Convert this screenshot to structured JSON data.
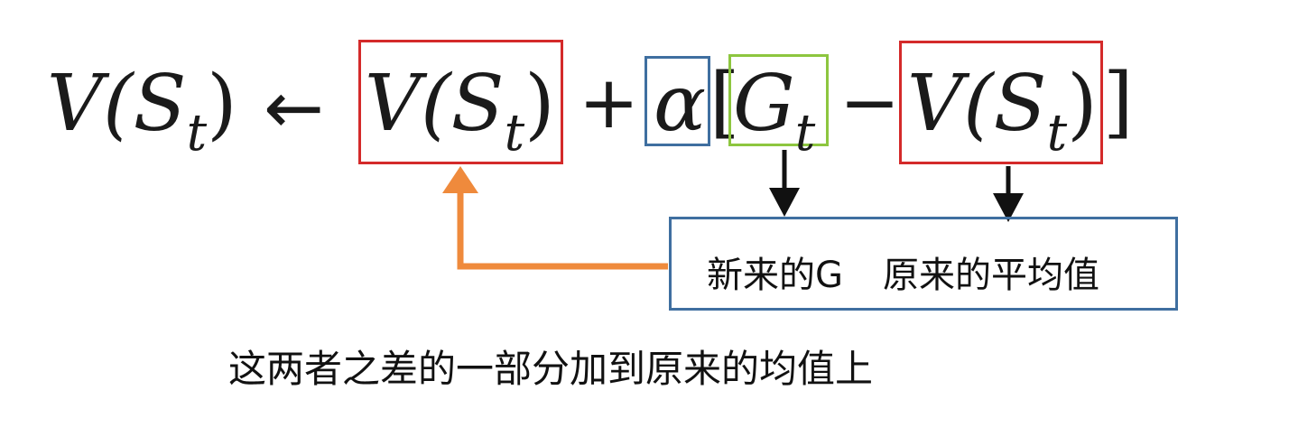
{
  "formula": {
    "lhs_V": "V",
    "lhs_S": "(S",
    "lhs_t": "t",
    "lhs_close": ")",
    "arrow": "←",
    "term1_V": "V",
    "term1_S": "(S",
    "term1_t": "t",
    "term1_close": ")",
    "plus": "+",
    "alpha": "α",
    "bracket_open": "[",
    "G": "G",
    "G_t": "t",
    "minus": "−",
    "term2_V": "V",
    "term2_S": "(S",
    "term2_t": "t",
    "term2_close": ")",
    "bracket_close": "]"
  },
  "annotation": {
    "label_new_G": "新来的G",
    "label_old_mean": "原来的平均值",
    "caption": "这两者之差的一部分加到原来的均值上"
  },
  "colors": {
    "red_box": "#d42a2a",
    "blue_box": "#3f6fa0",
    "green_box": "#8dc63f",
    "orange_arrow": "#ef8a3c",
    "black_arrow": "#111111"
  }
}
